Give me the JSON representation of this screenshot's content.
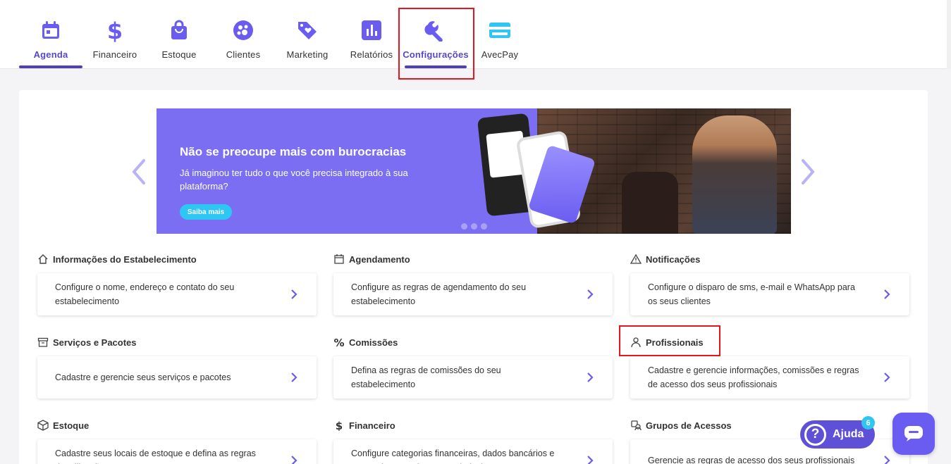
{
  "nav": {
    "items": [
      {
        "label": "Agenda"
      },
      {
        "label": "Financeiro"
      },
      {
        "label": "Estoque"
      },
      {
        "label": "Clientes"
      },
      {
        "label": "Marketing"
      },
      {
        "label": "Relatórios"
      },
      {
        "label": "Configurações"
      },
      {
        "label": "AvecPay"
      }
    ],
    "active": "Configurações"
  },
  "banner": {
    "title": "Não se preocupe mais com burocracias",
    "subtitle": "Já imaginou ter tudo o que você precisa integrado à sua plataforma?",
    "cta": "Saiba mais"
  },
  "sections": [
    {
      "title": "Informações do Estabelecimento",
      "icon": "home-icon",
      "text": "Configure o nome, endereço e contato do seu estabelecimento"
    },
    {
      "title": "Agendamento",
      "icon": "calendar-icon",
      "text": "Configure as regras de agendamento do seu estabelecimento"
    },
    {
      "title": "Notificações",
      "icon": "warning-icon",
      "text": "Configure o disparo de sms, e-mail e WhatsApp para os seus clientes"
    },
    {
      "title": "Serviços e Pacotes",
      "icon": "box-icon",
      "text": "Cadastre e gerencie seus serviços e pacotes"
    },
    {
      "title": "Comissões",
      "icon": "percent-icon",
      "text": "Defina as regras de comissões do seu estabelecimento"
    },
    {
      "title": "Profissionais",
      "icon": "person-icon",
      "text": "Cadastre e gerencie informações, comissões e regras de acesso dos seus profissionais"
    },
    {
      "title": "Estoque",
      "icon": "package-icon",
      "text": "Cadastre seus locais de estoque e defina as regras de utilização"
    },
    {
      "title": "Financeiro",
      "icon": "dollar-icon",
      "text": "Configure categorias financeiras, dados bancários e regras de taxas do seu estabelecimento"
    },
    {
      "title": "Grupos de Acessos",
      "icon": "group-icon",
      "text": "Gerencie as regras de acesso dos seus profissionais"
    }
  ],
  "help": {
    "label": "Ajuda",
    "badge": "6"
  },
  "colors": {
    "accent": "#5548c8",
    "icon": "#6a5cf0",
    "banner": "#7b6ef2",
    "highlight": "#e8141e"
  }
}
